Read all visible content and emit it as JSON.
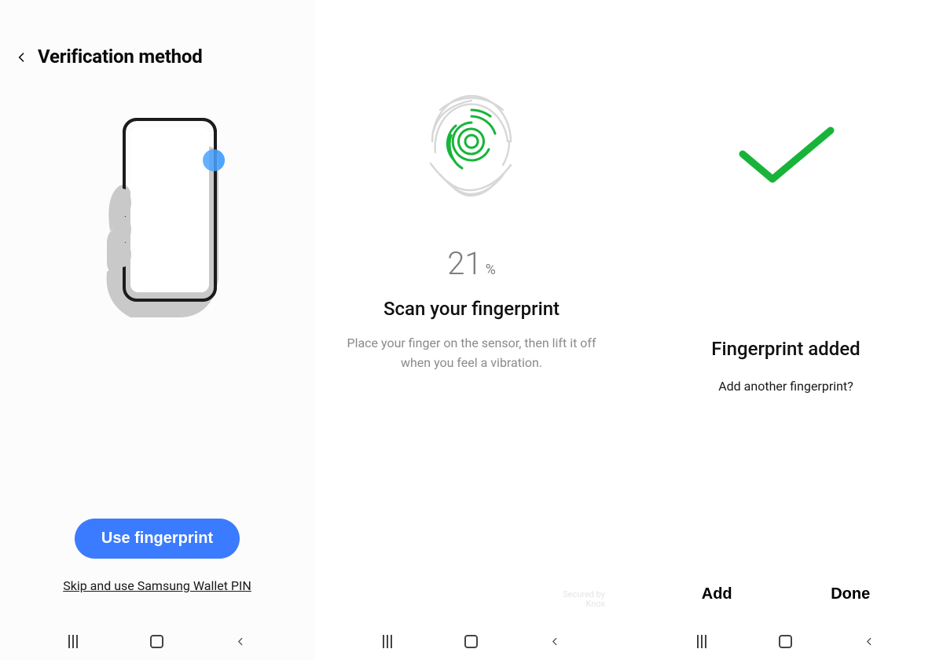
{
  "pane1": {
    "header_title": "Verification method",
    "primary_button": "Use fingerprint",
    "skip_link": "Skip and use Samsung Wallet PIN"
  },
  "pane2": {
    "progress_value": "21",
    "progress_unit": "%",
    "title": "Scan your fingerprint",
    "subtitle": "Place your finger on the sensor, then lift it off when you feel a vibration.",
    "secured_line1": "Secured by",
    "secured_line2": "Knox"
  },
  "pane3": {
    "title": "Fingerprint added",
    "subtitle": "Add another fingerprint?",
    "add_button": "Add",
    "done_button": "Done"
  },
  "colors": {
    "primary": "#3b7bff",
    "accent_green": "#18b43a",
    "success_check": "#18b43a"
  },
  "icons": {
    "back": "chevron-left-icon",
    "fingerprint": "fingerprint-icon",
    "check": "check-icon",
    "nav_recents": "recents-icon",
    "nav_home": "home-icon",
    "nav_back": "back-icon"
  }
}
